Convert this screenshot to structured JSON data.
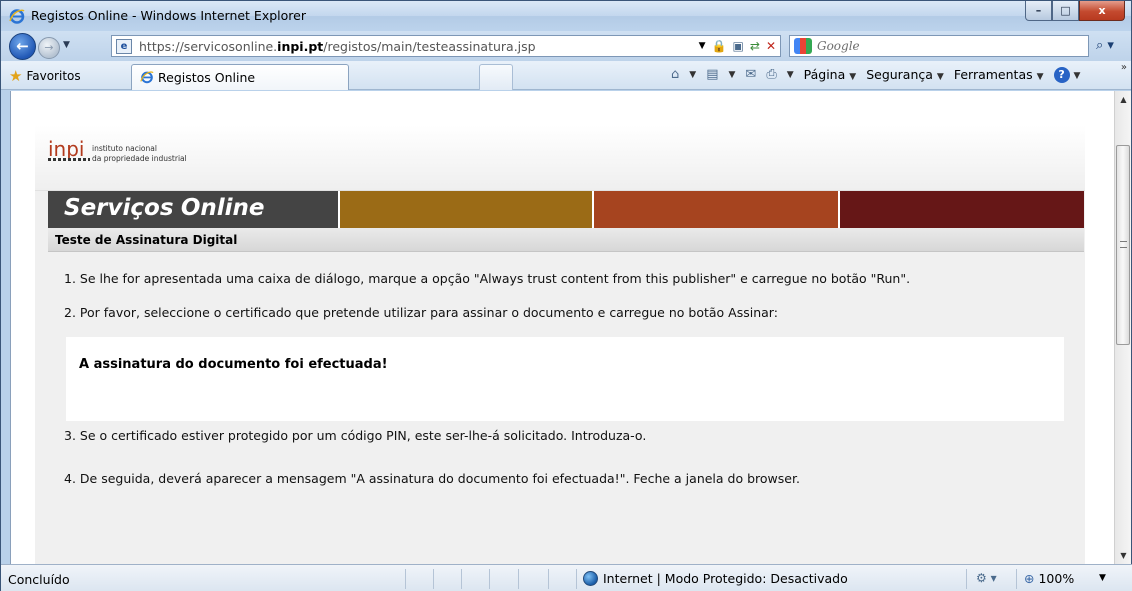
{
  "window": {
    "title": "Registos Online - Windows Internet Explorer",
    "minimize": "–",
    "maximize": "□",
    "close": "x"
  },
  "address": {
    "url_prefix": "https://servicosonline.",
    "url_domain": "inpi.pt",
    "url_path": "/registos/main/testeassinatura.jsp",
    "search_placeholder": "Google"
  },
  "favorites": {
    "label": "Favoritos",
    "tab_title": "Registos Online"
  },
  "commands": {
    "pagina": "Página",
    "seguranca": "Segurança",
    "ferramentas": "Ferramentas"
  },
  "page": {
    "logo": "inpi",
    "logo_sub1": "instituto nacional",
    "logo_sub2": "da propriedade industrial",
    "banner_bold": "Serviços",
    "banner_light": "Online",
    "section_title": "Teste de Assinatura Digital",
    "step1": "1. Se lhe for apresentada uma caixa de diálogo, marque a opção \"Always trust content from this publisher\" e carregue no botão \"Run\".",
    "step2": "2. Por favor, seleccione o certificado que pretende utilizar para assinar o documento e carregue no botão Assinar:",
    "result": "A assinatura do documento foi efectuada!",
    "step3": "3. Se o certificado estiver protegido por um código PIN, este ser-lhe-á solicitado. Introduza-o.",
    "step4": "4. De seguida, deverá aparecer a mensagem \"A assinatura do documento foi efectuada!\". Feche a janela do browser."
  },
  "status": {
    "text": "Concluído",
    "zone": "Internet | Modo Protegido: Desactivado",
    "zoom": "100%"
  },
  "colors": {
    "banner_dark": "#444444",
    "banner_gold": "#9b6b16",
    "banner_orange": "#a6441f",
    "banner_maroon": "#661717"
  }
}
